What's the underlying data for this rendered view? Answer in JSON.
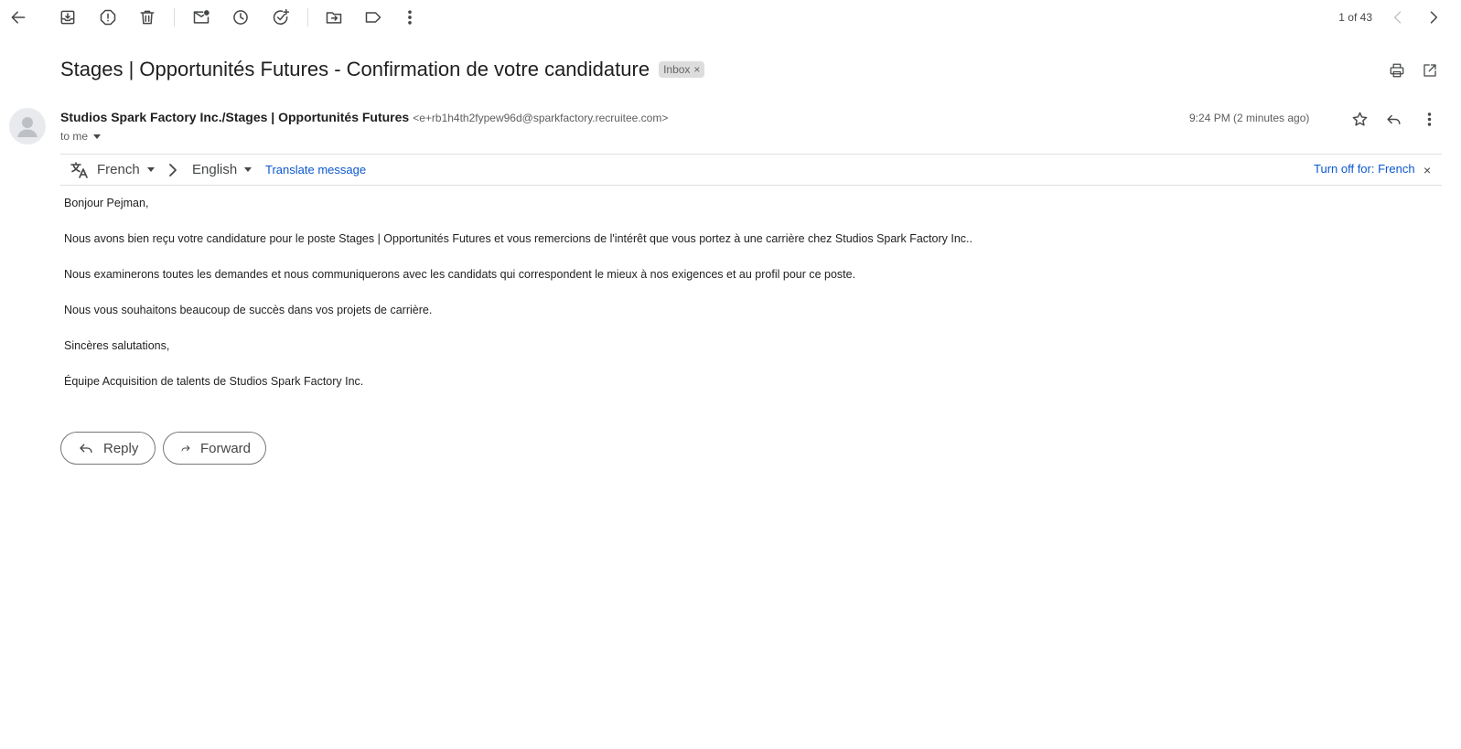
{
  "toolbar": {
    "pager_text": "1 of 43"
  },
  "subject": {
    "title": "Stages | Opportunités Futures - Confirmation de votre candidature",
    "label_chip": "Inbox",
    "chip_close": "×"
  },
  "message": {
    "sender_name": "Studios Spark Factory Inc./Stages | Opportunités Futures",
    "sender_email": "<e+rb1h4th2fypew96d@sparkfactory.recruitee.com>",
    "recipient": "to me",
    "timestamp": "9:24 PM (2 minutes ago)"
  },
  "translate_bar": {
    "source_language": "French",
    "target_language": "English",
    "translate_link": "Translate message",
    "turn_off": "Turn off for: French",
    "close": "×"
  },
  "body": {
    "greeting": "Bonjour Pejman,",
    "paragraph_1": "Nous avons bien reçu votre candidature pour le poste Stages | Opportunités Futures et vous remercions de l'intérêt que vous portez à une carrière chez Studios Spark Factory Inc..",
    "paragraph_2": "Nous examinerons toutes les demandes et nous communiquerons avec les candidats qui correspondent le mieux à nos exigences et au profil pour ce poste.",
    "paragraph_3": "Nous vous souhaitons beaucoup de succès dans vos projets de carrière.",
    "closing": "Sincères salutations,",
    "signature": "Équipe Acquisition de talents de Studios Spark Factory Inc."
  },
  "actions": {
    "reply_label": "Reply",
    "forward_label": "Forward"
  },
  "colors": {
    "link": "#0b57d0",
    "icon": "#444746",
    "chip_bg": "#dddddd"
  },
  "icons": [
    "back-arrow-icon",
    "archive-icon",
    "report-spam-icon",
    "delete-icon",
    "mark-unread-icon",
    "snooze-icon",
    "add-task-icon",
    "move-to-icon",
    "label-icon",
    "more-vert-icon",
    "chevron-left-icon",
    "chevron-right-icon",
    "print-icon",
    "open-new-window-icon",
    "star-icon",
    "reply-icon",
    "translate-icon"
  ]
}
